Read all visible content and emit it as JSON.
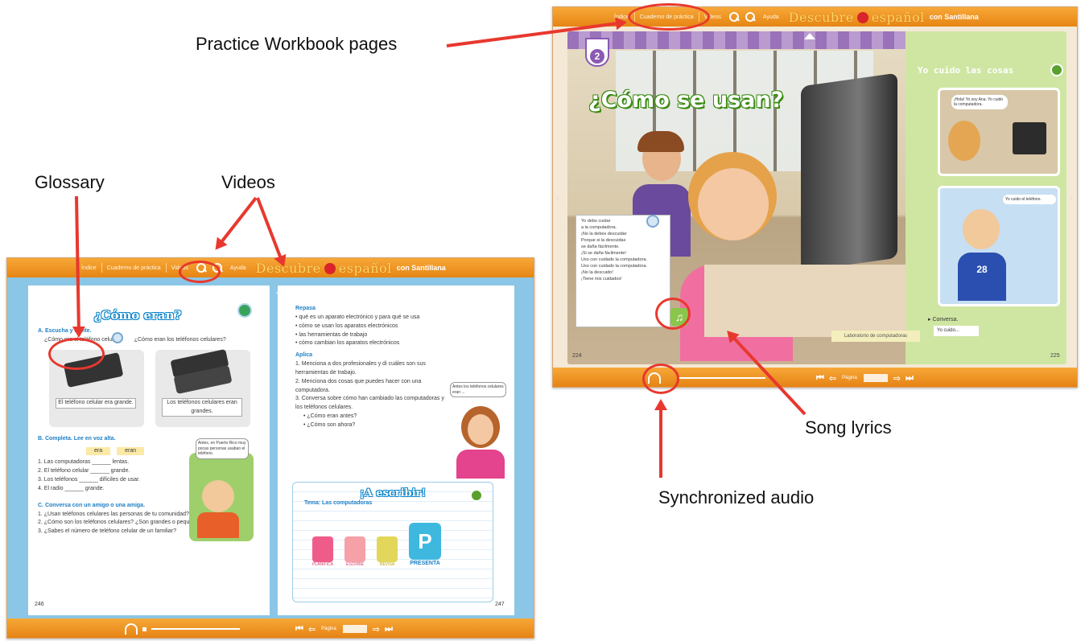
{
  "callouts": {
    "workbook": "Practice Workbook pages",
    "glossary": "Glossary",
    "videos": "Videos",
    "lyrics": "Song lyrics",
    "audio": "Synchronized audio"
  },
  "toolbar": {
    "index": "Índice",
    "workbook": "Cuaderno de práctica",
    "videos": "Videos",
    "help": "Ayuda",
    "brand1": "Descubre",
    "brand2": "español",
    "brand_with": "con Santillana"
  },
  "bottombar": {
    "page_label": "Página"
  },
  "left_book": {
    "left_page": {
      "title": "¿Cómo eran?",
      "a_intro": "A. Escucha y repite.",
      "q1": "¿Cómo era el teléfono celular?",
      "q2": "¿Cómo eran los teléfonos celulares?",
      "cap1": "El teléfono celular era grande.",
      "cap2": "Los teléfonos celulares eran grandes.",
      "b_intro": "B. Completa. Lee en voz alta.",
      "opt1": "era",
      "opt2": "eran",
      "b_items": [
        "1. Las computadoras ______ lentas.",
        "2. El teléfono celular ______ grande.",
        "3. Los teléfonos ______ difíciles de usar.",
        "4. El radio ______ grande."
      ],
      "bubble": "Antes, en Puerto Rico muy pocas personas usaban el teléfono.",
      "c_intro": "C. Conversa con un amigo o una amiga.",
      "c_items": [
        "1. ¿Usan teléfonos celulares las personas de tu comunidad?",
        "2. ¿Cómo son los teléfonos celulares? ¿Son grandes o pequeños?",
        "3. ¿Sabes el número de teléfono celular de un familiar?"
      ],
      "page_no": "246"
    },
    "right_page": {
      "repasa": "Repasa",
      "repasa_items": [
        "qué es un aparato electrónico y para qué se usa",
        "cómo se usan los aparatos electrónicos",
        "las herramientas de trabajo",
        "cómo cambian los aparatos electrónicos"
      ],
      "aplica": "Aplica",
      "aplica_items": [
        "1. Menciona a dos profesionales y di cuáles son sus herramientas de trabajo.",
        "2. Menciona dos cosas que puedes hacer con una computadora.",
        "3. Conversa sobre cómo han cambiado las computadoras y los teléfonos celulares."
      ],
      "sub_items": [
        "¿Cómo eran antes?",
        "¿Cómo son ahora?"
      ],
      "girl_bubble": "Antes los teléfonos celulares eran ...",
      "escribir": "¡A escribir!",
      "tema": "Tema: Las computadoras",
      "steps": [
        "PLANIFICA",
        "ESCRIBE",
        "REVISA",
        "PRESENTA"
      ],
      "page_no": "247"
    }
  },
  "right_book": {
    "badge": "2",
    "title": "¿Cómo se usan?",
    "side_title": "Yo cuido las cosas",
    "bubble1": "¡Hola! Yo soy Ana. Yo cuido la computadora.",
    "bubble2": "Yo cuido el teléfono.",
    "song": [
      "Yo debo cuidar",
      "a la computadora.",
      "¡No la debes descuidar",
      "Porque si la descuidas",
      "se daña fácilmente.",
      "¡Si se daña fácilmente!",
      "Uso con cuidado la computadora.",
      "Uso con cuidado la computadora.",
      "¡No la descuido!",
      "¡Tiene mis cuidados!"
    ],
    "lab": "Laboratorio de computadoras",
    "conversa": "Conversa.",
    "cuido": "Yo cuido...",
    "page_left": "224",
    "page_right": "225",
    "shirt": "28"
  }
}
